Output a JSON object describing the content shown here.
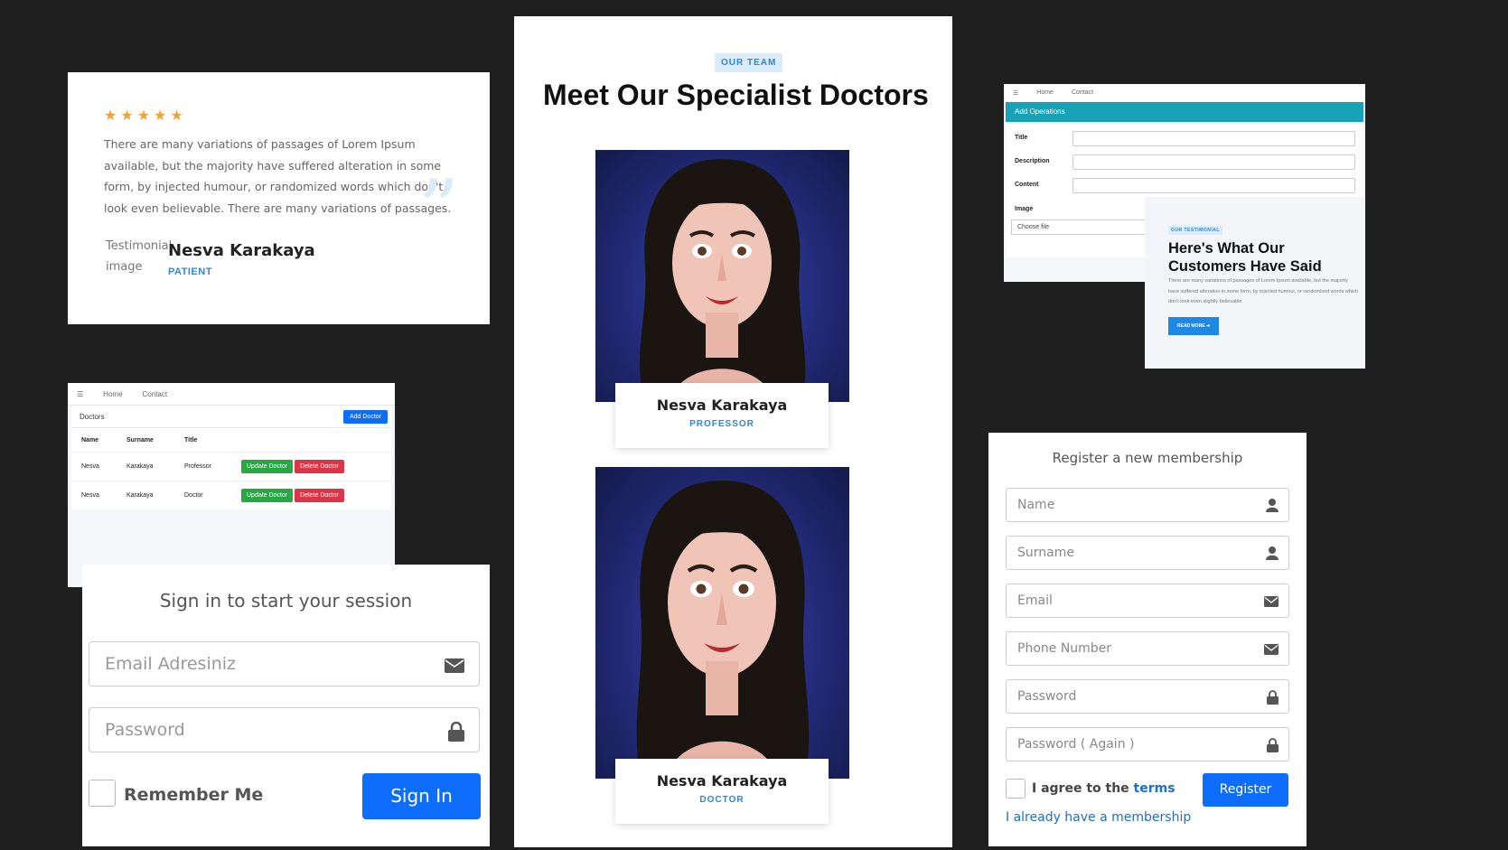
{
  "testimonial": {
    "stars": "★★★★★",
    "text": "There are many variations of passages of Lorem Ipsum available, but the majority have suffered alteration in some form, by injected humour, or randomized words which don't look even believable. There are many variations of passages.",
    "quote_mark": "”",
    "image_alt": "Testimonial image",
    "name": "Nesva Karakaya",
    "role": "PATIENT"
  },
  "doctors_admin": {
    "menu_icon": "☰",
    "nav": [
      "Home",
      "Contact"
    ],
    "title": "Doctors",
    "add_button": "Add Doctor",
    "columns": [
      "Name",
      "Surname",
      "Title"
    ],
    "rows": [
      {
        "name": "Nesva",
        "surname": "Karakaya",
        "title": "Professor",
        "update": "Update Doctor",
        "delete": "Delete Doctor"
      },
      {
        "name": "Nesva",
        "surname": "Karakaya",
        "title": "Doctor",
        "update": "Update Doctor",
        "delete": "Delete Doctor"
      }
    ]
  },
  "signin": {
    "title": "Sign in to start your session",
    "email_placeholder": "Email Adresiniz",
    "password_placeholder": "Password",
    "remember": "Remember Me",
    "button": "Sign In",
    "icons": [
      "envelope-icon",
      "lock-icon"
    ]
  },
  "team": {
    "badge": "OUR TEAM",
    "title": "Meet Our Specialist Doctors",
    "doctors": [
      {
        "name": "Nesva Karakaya",
        "role": "PROFESSOR"
      },
      {
        "name": "Nesva Karakaya",
        "role": "DOCTOR"
      }
    ]
  },
  "operations": {
    "menu_icon": "☰",
    "nav": [
      "Home",
      "Contact"
    ],
    "header": "Add Operations",
    "fields": [
      "Title",
      "Description",
      "Content"
    ],
    "image_label": "Image",
    "file_placeholder": "Choose file"
  },
  "customers": {
    "badge": "OUR TESTIMONIAL",
    "title_line1": "Here's What Our",
    "title_line2": "Customers Have Said",
    "text": "There are many variations of passages of Lorem Ipsum available, but the majority have suffered alteration in some form, by injected humour, or randomised words which don't look even slightly believable",
    "button": "READ MORE ➔"
  },
  "register": {
    "title": "Register a new membership",
    "placeholders": [
      "Name",
      "Surname",
      "Email",
      "Phone Number",
      "Password",
      "Password ( Again )"
    ],
    "agree": "I agree to the ",
    "terms": "terms",
    "button": "Register",
    "login_link": "I already have a membership",
    "icons": [
      "user-icon",
      "user-icon",
      "envelope-icon",
      "envelope-icon",
      "lock-icon",
      "lock-icon"
    ]
  }
}
